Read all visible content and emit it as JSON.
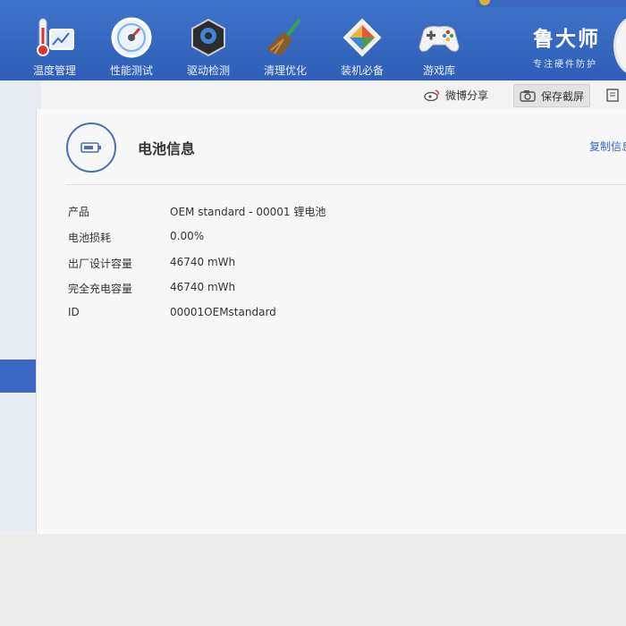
{
  "nav": {
    "items": [
      {
        "label": "温度管理",
        "icon": "thermometer-icon"
      },
      {
        "label": "性能测试",
        "icon": "speedometer-icon"
      },
      {
        "label": "驱动检测",
        "icon": "gear-chip-icon"
      },
      {
        "label": "清理优化",
        "icon": "broom-icon"
      },
      {
        "label": "装机必备",
        "icon": "box-icon"
      },
      {
        "label": "游戏库",
        "icon": "gamepad-icon"
      }
    ]
  },
  "brand": {
    "name": "鲁大师",
    "slogan": "专注硬件防护"
  },
  "toolbar": {
    "share_label": "微博分享",
    "save_label": "保存截屏"
  },
  "section": {
    "title": "电池信息",
    "copy_label": "复制信息"
  },
  "battery": {
    "rows": [
      {
        "key": "产品",
        "value": "OEM standard - 00001 锂电池"
      },
      {
        "key": "电池损耗",
        "value": "0.00%"
      },
      {
        "key": "出厂设计容量",
        "value": "46740 mWh"
      },
      {
        "key": "完全充电容量",
        "value": "46740 mWh"
      },
      {
        "key": "ID",
        "value": "00001OEMstandard"
      }
    ]
  },
  "colors": {
    "header": "#2f5fb8",
    "accent": "#3a66c4",
    "panel": "#f7f7f7"
  }
}
